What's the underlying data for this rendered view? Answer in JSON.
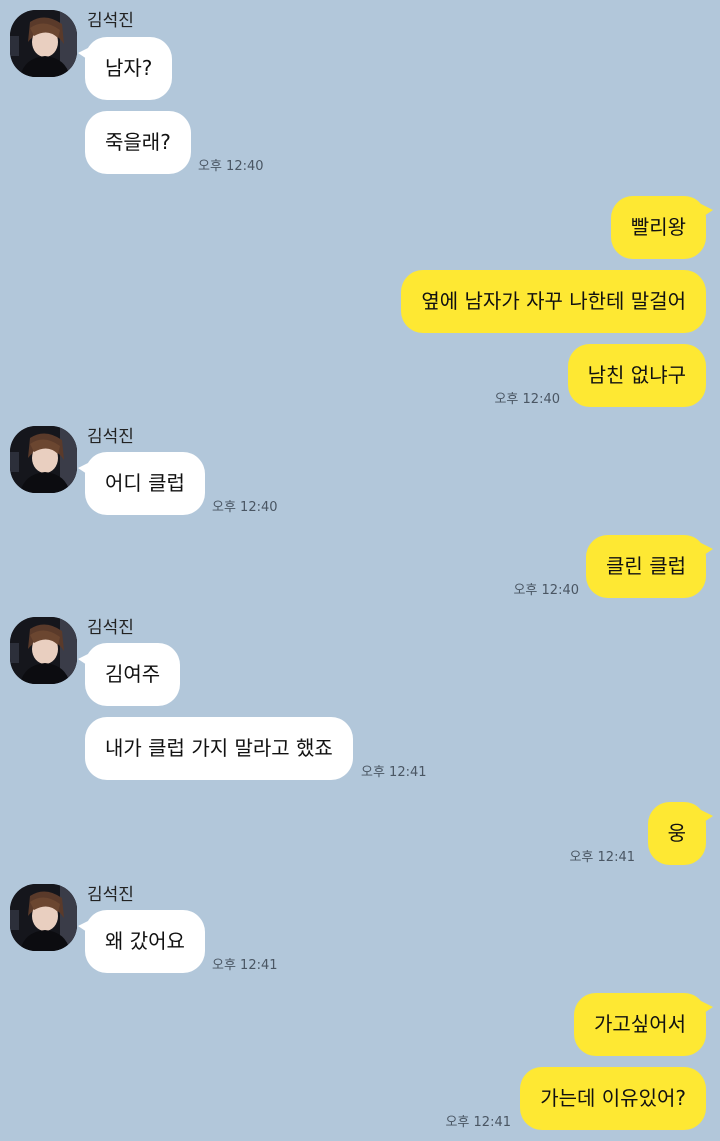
{
  "chat": {
    "background_color": "#b2c7da",
    "incoming_bubble_color": "#ffffff",
    "outgoing_bubble_color": "#fee833",
    "contact_name": "김석진",
    "groups": [
      {
        "side": "in",
        "sender": "김석진",
        "messages": [
          "남자?",
          "죽을래?"
        ],
        "time": "오후 12:40"
      },
      {
        "side": "out",
        "messages": [
          "빨리왕",
          "옆에 남자가 자꾸 나한테 말걸어",
          "남친 없냐구"
        ],
        "time": "오후 12:40"
      },
      {
        "side": "in",
        "sender": "김석진",
        "messages": [
          "어디 클럽"
        ],
        "time": "오후 12:40"
      },
      {
        "side": "out",
        "messages": [
          "클린 클럽"
        ],
        "time": "오후 12:40"
      },
      {
        "side": "in",
        "sender": "김석진",
        "messages": [
          "김여주",
          "내가 클럽 가지 말라고 했죠"
        ],
        "time": "오후 12:41"
      },
      {
        "side": "out",
        "messages": [
          "웅"
        ],
        "time": "오후 12:41"
      },
      {
        "side": "in",
        "sender": "김석진",
        "messages": [
          "왜 갔어요"
        ],
        "time": "오후 12:41"
      },
      {
        "side": "out",
        "messages": [
          "가고싶어서",
          "가는데 이유있어?"
        ],
        "time": "오후 12:41"
      }
    ]
  }
}
